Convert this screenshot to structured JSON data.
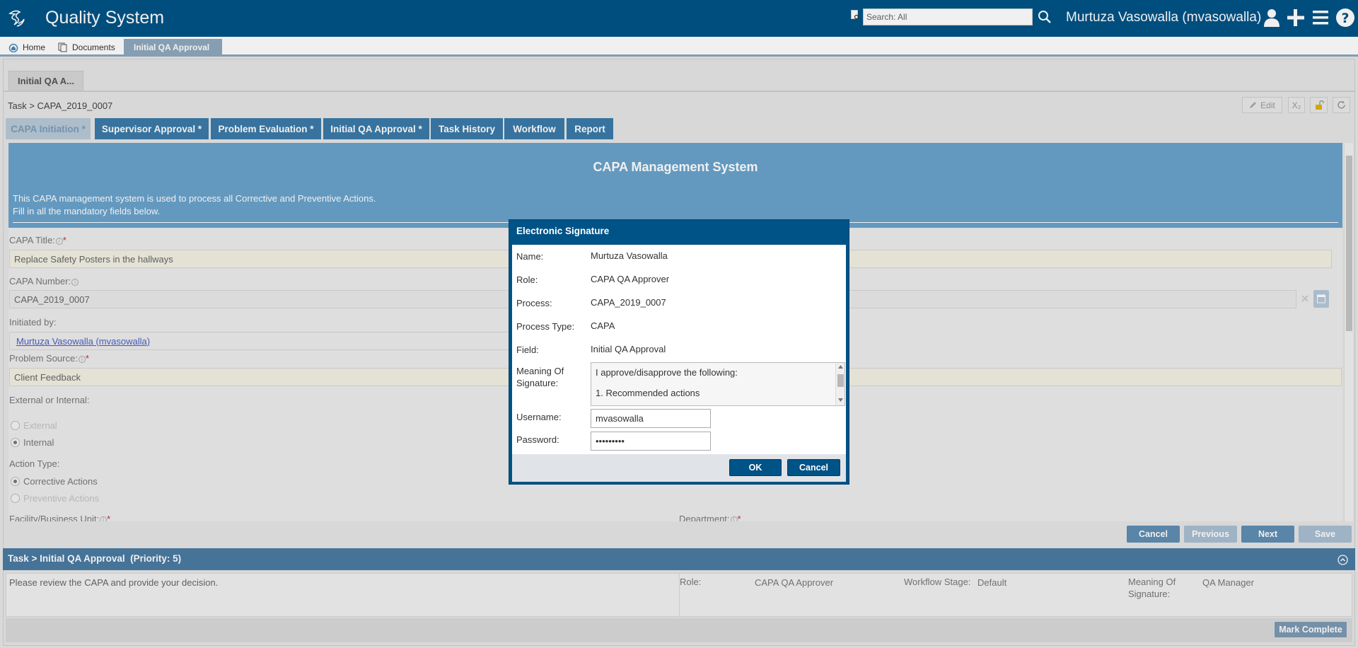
{
  "app": {
    "title": "Quality System",
    "user": "Murtuza Vasowalla (mvasowalla)"
  },
  "search": {
    "placeholder": "Search: All"
  },
  "nav": {
    "tabs": [
      "Home",
      "Documents",
      "Initial QA Approval"
    ]
  },
  "page": {
    "tab_label": "Initial QA A...",
    "breadcrumb": "Task > CAPA_2019_0007",
    "edit_label": "Edit",
    "subscript_label": "X₂"
  },
  "form_tabs": [
    "CAPA Initiation *",
    "Supervisor Approval *",
    "Problem Evaluation *",
    "Initial QA Approval *",
    "Task History",
    "Workflow",
    "Report"
  ],
  "banner": {
    "title": "CAPA Management System",
    "line1": "This CAPA management system is used to process all Corrective and Preventive Actions.",
    "line2": "Fill in all the mandatory fields below."
  },
  "form": {
    "capa_title_label": "CAPA Title:",
    "capa_title_value": "Replace Safety Posters in the hallways",
    "capa_number_label": "CAPA Number:",
    "capa_number_value": "CAPA_2019_0007",
    "initiated_by_label": "Initiated by:",
    "initiated_by_value": "Murtuza Vasowalla (mvasowalla)",
    "problem_source_label": "Problem Source:",
    "problem_source_value": "Client Feedback",
    "ext_int_label": "External or Internal:",
    "ext_option": "External",
    "int_option": "Internal",
    "action_type_label": "Action Type:",
    "corrective_option": "Corrective Actions",
    "preventive_option": "Preventive Actions",
    "facility_label": "Facility/Business Unit:",
    "department_label": "Department:",
    "required_mark": "*"
  },
  "actions": {
    "cancel": "Cancel",
    "previous": "Previous",
    "next": "Next",
    "save": "Save"
  },
  "task": {
    "header": "Task > Initial QA Approval  (Priority: 5)",
    "description": "Please review the CAPA and provide your decision.",
    "role_label": "Role:",
    "role_value": "CAPA QA Approver",
    "stage_label": "Workflow Stage:",
    "stage_value": "Default",
    "meaning_label_1": "Meaning Of",
    "meaning_label_2": "Signature:",
    "meaning_value": "QA Manager",
    "mark_complete": "Mark Complete"
  },
  "signature": {
    "title": "Electronic Signature",
    "name_label": "Name:",
    "name_value": "Murtuza Vasowalla",
    "role_label": "Role:",
    "role_value": "CAPA QA Approver",
    "process_label": "Process:",
    "process_value": "CAPA_2019_0007",
    "ptype_label": "Process Type:",
    "ptype_value": "CAPA",
    "field_label": "Field:",
    "field_value": "Initial QA Approval",
    "meaning_label_1": "Meaning Of",
    "meaning_label_2": "Signature:",
    "meaning_line1": "I approve/disapprove the following:",
    "meaning_line2": "1. Recommended actions",
    "username_label": "Username:",
    "username_value": "mvasowalla",
    "password_label": "Password:",
    "password_value": "•••••••••",
    "ok": "OK",
    "cancel": "Cancel"
  },
  "colors": {
    "brand": "#005386",
    "tab": "#3b7ba8",
    "banner": "#6ba3cb",
    "required": "#b33333"
  }
}
